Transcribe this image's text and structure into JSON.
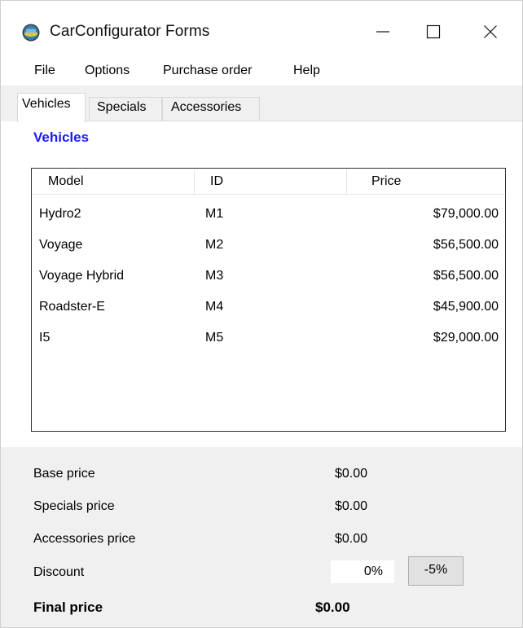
{
  "window": {
    "title": "CarConfigurator Forms"
  },
  "menu": {
    "items": [
      "File",
      "Options",
      "Purchase order",
      "Help"
    ]
  },
  "tabs": [
    {
      "label": "Vehicles",
      "active": true
    },
    {
      "label": "Specials",
      "active": false
    },
    {
      "label": "Accessories",
      "active": false
    }
  ],
  "vehicles": {
    "section_title": "Vehicles",
    "columns": [
      "Model",
      "ID",
      "Price"
    ],
    "rows": [
      {
        "model": "Hydro2",
        "id": "M1",
        "price": "$79,000.00"
      },
      {
        "model": "Voyage",
        "id": "M2",
        "price": "$56,500.00"
      },
      {
        "model": "Voyage Hybrid",
        "id": "M3",
        "price": "$56,500.00"
      },
      {
        "model": "Roadster-E",
        "id": "M4",
        "price": "$45,900.00"
      },
      {
        "model": "I5",
        "id": "M5",
        "price": "$29,000.00"
      }
    ]
  },
  "summary": {
    "base_label": "Base price",
    "base_value": "$0.00",
    "specials_label": "Specials price",
    "specials_value": "$0.00",
    "accessories_label": "Accessories price",
    "accessories_value": "$0.00",
    "discount_label": "Discount",
    "discount_value": "0%",
    "discount_button": "-5%",
    "final_label": "Final price",
    "final_value": "$0.00"
  },
  "colors": {
    "section_title": "#1a1aff",
    "panel_bg": "#f0f0f0"
  },
  "icons": {
    "app": "car-icon",
    "minimize": "minimize-icon",
    "maximize": "maximize-icon",
    "close": "close-icon"
  }
}
